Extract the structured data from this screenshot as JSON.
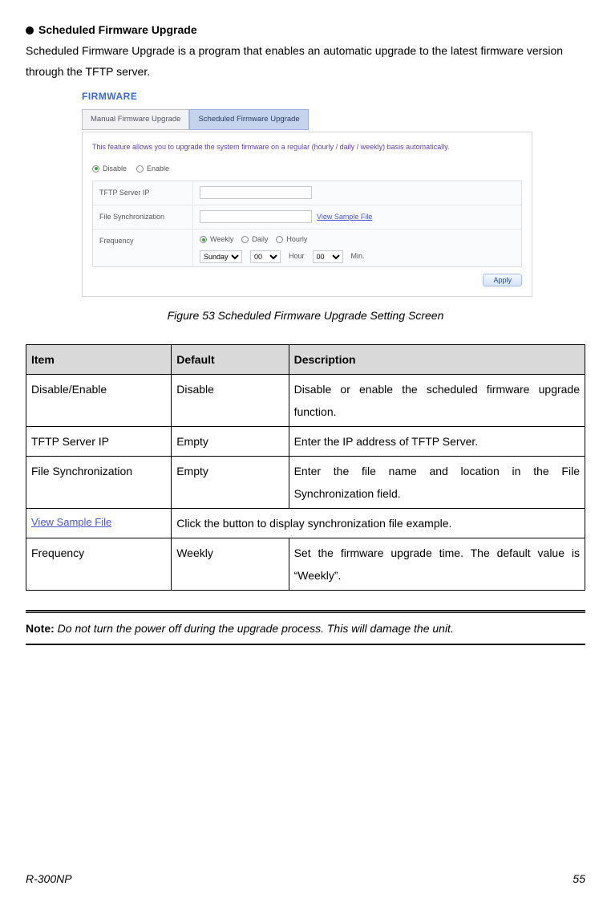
{
  "heading": {
    "title": "Scheduled Firmware Upgrade"
  },
  "intro": "Scheduled Firmware Upgrade is a program that enables an automatic upgrade to the latest firmware version through the TFTP server.",
  "figure": {
    "brand": "FIRMWARE",
    "tabs": {
      "manual": "Manual Firmware Upgrade",
      "scheduled": "Scheduled Firmware Upgrade"
    },
    "panel_desc": "This feature allows you to upgrade the system firmware on a regular (hourly / daily / weekly) basis automatically.",
    "disable_label": "Disable",
    "enable_label": "Enable",
    "rows": {
      "tftp": "TFTP Server IP",
      "filesync": "File Synchronization",
      "frequency": "Frequency"
    },
    "view_sample": "View Sample File",
    "freq_opts": {
      "weekly": "Weekly",
      "daily": "Daily",
      "hourly": "Hourly"
    },
    "day_sel": "Sunday",
    "hour_sel": "00",
    "min_sel": "00",
    "hour_txt": "Hour",
    "min_txt": "Min.",
    "apply": "Apply",
    "caption": "Figure 53 Scheduled Firmware Upgrade Setting Screen"
  },
  "table": {
    "headers": {
      "item": "Item",
      "default": "Default",
      "description": "Description"
    },
    "rows": [
      {
        "item": "Disable/Enable",
        "default": "Disable",
        "desc": "Disable or enable the scheduled firmware upgrade function."
      },
      {
        "item": "TFTP Server IP",
        "default": "Empty",
        "desc": "Enter the IP address of TFTP Server."
      },
      {
        "item": "File Synchronization",
        "default": "Empty",
        "desc": "Enter the file name and location in the File Synchronization field."
      },
      {
        "item_link": "View Sample File",
        "desc_full": "Click the button to display synchronization file example."
      },
      {
        "item": "Frequency",
        "default": "Weekly",
        "desc": "Set the firmware upgrade time. The default value is “Weekly”."
      }
    ]
  },
  "note": {
    "label": "Note:",
    "text": " Do not turn the power off during the upgrade process. This will damage the unit."
  },
  "footer": {
    "model": "R-300NP",
    "page": "55"
  }
}
